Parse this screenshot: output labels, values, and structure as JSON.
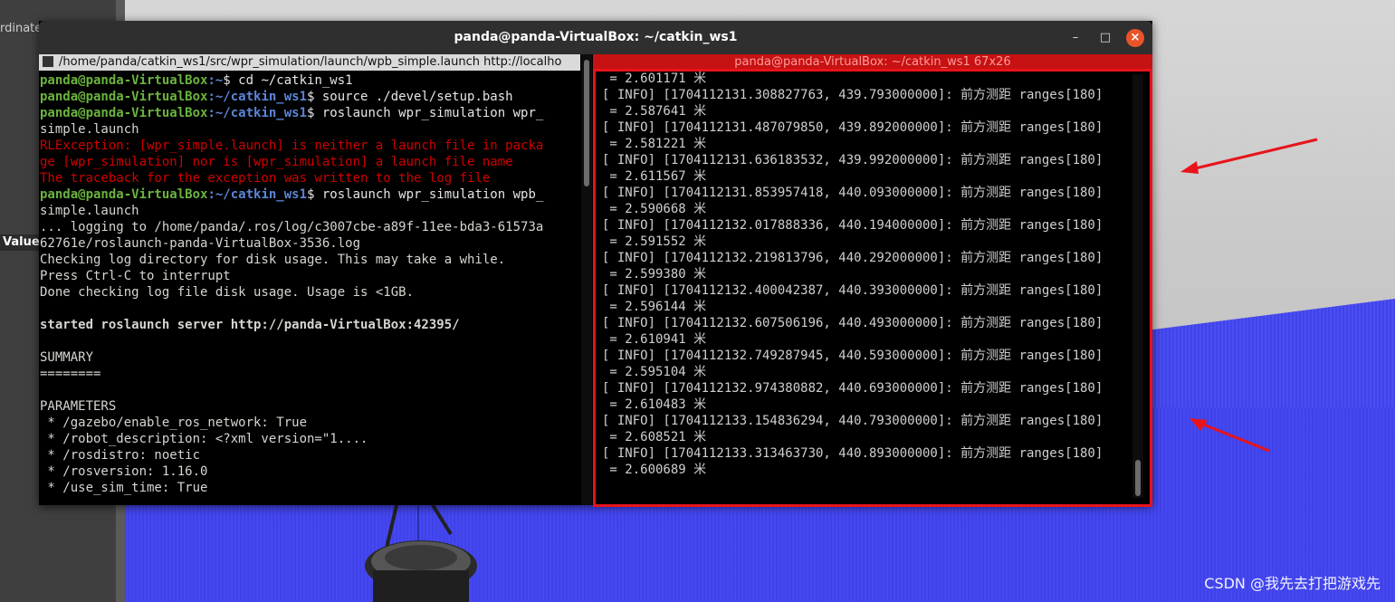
{
  "desktop": {
    "left_label": "rdinate",
    "value_chip": "Value",
    "watermark": "CSDN @我先去打把游戏先"
  },
  "window": {
    "title": "panda@panda-VirtualBox: ~/catkin_ws1",
    "buttons": {
      "minimize": "–",
      "maximize": "□",
      "close": "×"
    }
  },
  "left_pane": {
    "tab_title": "/home/panda/catkin_ws1/src/wpr_simulation/launch/wpb_simple.launch http://localho",
    "lines": [
      {
        "user": "panda@panda-VirtualBox",
        "path": ":~",
        "cmd": "$ cd ~/catkin_ws1"
      },
      {
        "user": "panda@panda-VirtualBox",
        "path": ":~/catkin_ws1",
        "cmd": "$ source ./devel/setup.bash"
      },
      {
        "user": "panda@panda-VirtualBox",
        "path": ":~/catkin_ws1",
        "cmd": "$ roslaunch wpr_simulation wpr_"
      },
      {
        "text": "simple.launch"
      },
      {
        "error": "RLException: [wpr_simple.launch] is neither a launch file in packa"
      },
      {
        "error": "ge [wpr_simulation] nor is [wpr_simulation] a launch file name"
      },
      {
        "error": "The traceback for the exception was written to the log file"
      },
      {
        "user": "panda@panda-VirtualBox",
        "path": ":~/catkin_ws1",
        "cmd": "$ roslaunch wpr_simulation wpb_"
      },
      {
        "text": "simple.launch"
      },
      {
        "text": "... logging to /home/panda/.ros/log/c3007cbe-a89f-11ee-bda3-61573a"
      },
      {
        "text": "62761e/roslaunch-panda-VirtualBox-3536.log"
      },
      {
        "text": "Checking log directory for disk usage. This may take a while."
      },
      {
        "text": "Press Ctrl-C to interrupt"
      },
      {
        "text": "Done checking log file disk usage. Usage is <1GB."
      },
      {
        "text": ""
      },
      {
        "bold": "started roslaunch server http://panda-VirtualBox:42395/"
      },
      {
        "text": ""
      },
      {
        "text": "SUMMARY"
      },
      {
        "text": "========"
      },
      {
        "text": ""
      },
      {
        "text": "PARAMETERS"
      },
      {
        "text": " * /gazebo/enable_ros_network: True"
      },
      {
        "text": " * /robot_description: <?xml version=\"1...."
      },
      {
        "text": " * /rosdistro: noetic"
      },
      {
        "text": " * /rosversion: 1.16.0"
      },
      {
        "text": " * /use_sim_time: True"
      }
    ]
  },
  "right_pane": {
    "tab_title": "panda@panda-VirtualBox: ~/catkin_ws1 67x26",
    "lines": [
      " = 2.601171 米",
      "[ INFO] [1704112131.308827763, 439.793000000]: 前方测距 ranges[180]",
      " = 2.587641 米",
      "[ INFO] [1704112131.487079850, 439.892000000]: 前方测距 ranges[180]",
      " = 2.581221 米",
      "[ INFO] [1704112131.636183532, 439.992000000]: 前方测距 ranges[180]",
      " = 2.611567 米",
      "[ INFO] [1704112131.853957418, 440.093000000]: 前方测距 ranges[180]",
      " = 2.590668 米",
      "[ INFO] [1704112132.017888336, 440.194000000]: 前方测距 ranges[180]",
      " = 2.591552 米",
      "[ INFO] [1704112132.219813796, 440.292000000]: 前方测距 ranges[180]",
      " = 2.599380 米",
      "[ INFO] [1704112132.400042387, 440.393000000]: 前方测距 ranges[180]",
      " = 2.596144 米",
      "[ INFO] [1704112132.607506196, 440.493000000]: 前方测距 ranges[180]",
      " = 2.610941 米",
      "[ INFO] [1704112132.749287945, 440.593000000]: 前方测距 ranges[180]",
      " = 2.595104 米",
      "[ INFO] [1704112132.974380882, 440.693000000]: 前方测距 ranges[180]",
      " = 2.610483 米",
      "[ INFO] [1704112133.154836294, 440.793000000]: 前方测距 ranges[180]",
      " = 2.608521 米",
      "[ INFO] [1704112133.313463730, 440.893000000]: 前方测距 ranges[180]",
      " = 2.600689 米"
    ]
  },
  "colors": {
    "prompt_user": "#6bb33d",
    "prompt_path": "#5b86d6",
    "error": "#d00000",
    "highlight_frame": "#e8131b",
    "close_button": "#e9542b"
  }
}
